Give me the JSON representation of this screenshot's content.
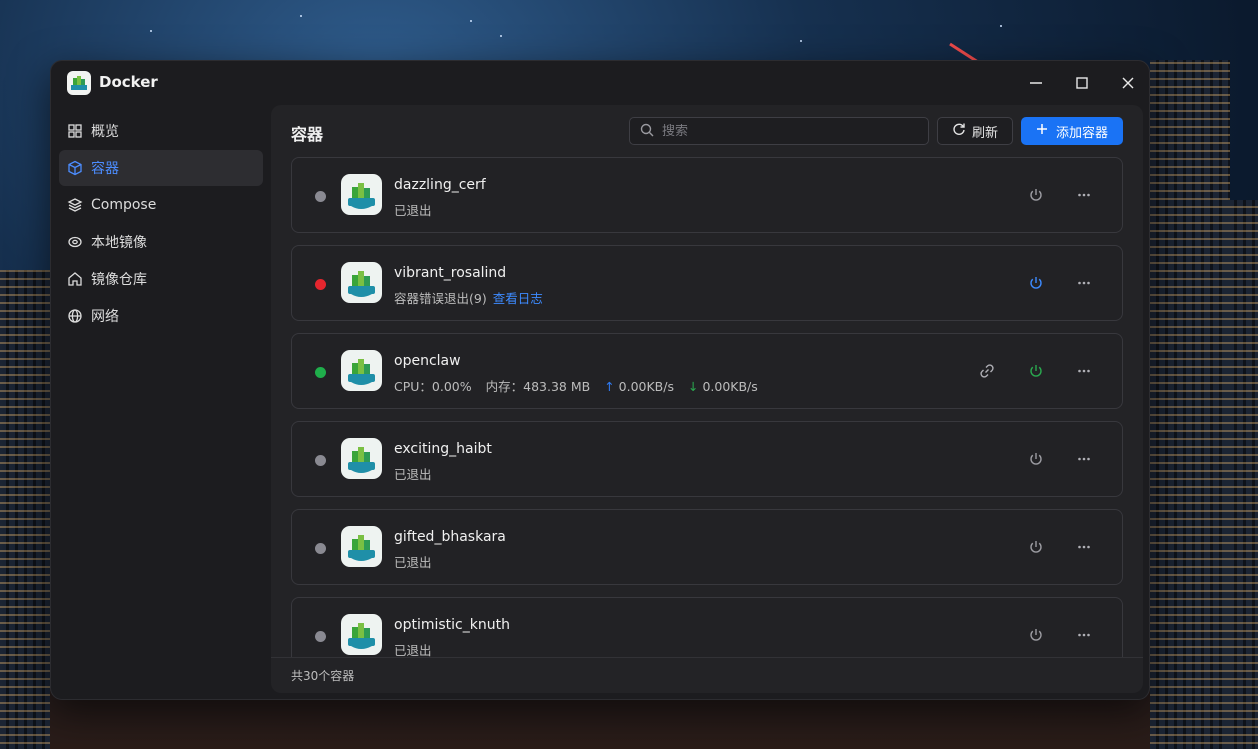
{
  "app": {
    "title": "Docker"
  },
  "window_controls": {
    "minimize": "—",
    "maximize": "☐",
    "close": "✕"
  },
  "sidebar": {
    "items": [
      {
        "label": "概览",
        "icon": "grid-icon",
        "active": false
      },
      {
        "label": "容器",
        "icon": "cube-icon",
        "active": true
      },
      {
        "label": "Compose",
        "icon": "layers-icon",
        "active": false
      },
      {
        "label": "本地镜像",
        "icon": "disk-icon",
        "active": false
      },
      {
        "label": "镜像仓库",
        "icon": "home-icon",
        "active": false
      },
      {
        "label": "网络",
        "icon": "globe-icon",
        "active": false
      }
    ]
  },
  "main": {
    "title": "容器",
    "search_placeholder": "搜索",
    "refresh_label": "刷新",
    "add_label": "添加容器"
  },
  "containers": [
    {
      "name": "dazzling_cerf",
      "status": "已退出",
      "state": "exited",
      "dot_color": "#8a8a92",
      "power_color": "#9c9ca2"
    },
    {
      "name": "vibrant_rosalind",
      "status": "容器错误退出(9)",
      "link": "查看日志",
      "state": "error",
      "dot_color": "#e5262e",
      "power_color": "#3d8bff"
    },
    {
      "name": "openclaw",
      "state": "running",
      "dot_color": "#1fae4b",
      "power_color": "#2aa84f",
      "cpu": "CPU：0.00%",
      "mem": "内存：483.38 MB",
      "up": "0.00KB/s",
      "down": "0.00KB/s"
    },
    {
      "name": "exciting_haibt",
      "status": "已退出",
      "state": "exited",
      "dot_color": "#8a8a92",
      "power_color": "#9c9ca2"
    },
    {
      "name": "gifted_bhaskara",
      "status": "已退出",
      "state": "exited",
      "dot_color": "#8a8a92",
      "power_color": "#9c9ca2"
    },
    {
      "name": "optimistic_knuth",
      "status": "已退出",
      "state": "exited",
      "dot_color": "#8a8a92",
      "power_color": "#9c9ca2"
    }
  ],
  "footer": {
    "total": "共30个容器"
  }
}
